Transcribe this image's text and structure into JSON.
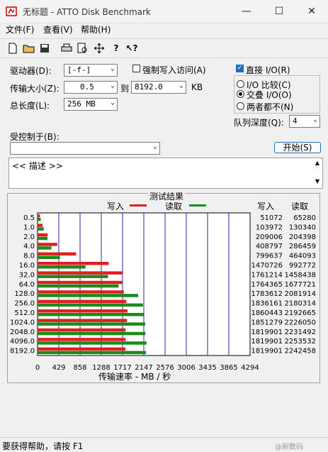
{
  "window": {
    "title": "无标题 - ATTO Disk Benchmark"
  },
  "menu": [
    "文件(F)",
    "查看(V)",
    "帮助(H)"
  ],
  "toolbar": {
    "new": "new-file",
    "open": "open-folder",
    "save": "save",
    "print": "print",
    "preview": "print-preview",
    "move": "move",
    "help": "help",
    "context_help": "context-help"
  },
  "form": {
    "drive_label": "驱动器(D):",
    "drive_value": "[-f-]",
    "force_write_label": "强制写入访问(A)",
    "transfer_label": "传输大小(Z):",
    "transfer_from": "0.5",
    "to_label": "到",
    "transfer_to": "8192.0",
    "kb_label": "KB",
    "length_label": "总长度(L):",
    "length_value": "256 MB",
    "direct_io_label": "直接 I/O(R)",
    "io_compare_label": "I/O 比较(C)",
    "overlap_io_label": "交叠 I/O(O)",
    "neither_label": "两者都不(N)",
    "queue_label": "队列深度(Q):",
    "queue_value": "4",
    "controlled_label": "受控制于(B):",
    "controlled_value": "",
    "start_button": "开始(S)",
    "description": "<< 描述 >>"
  },
  "results": {
    "title": "测试结果",
    "legend_write": "写入",
    "legend_read": "读取",
    "col_write": "写入",
    "col_read": "读取",
    "xlabel": "传输速率 - MB / 秒",
    "write_color": "#e02020",
    "read_color": "#1a8a1a"
  },
  "chart_data": {
    "type": "bar",
    "title": "测试结果",
    "xlabel": "传输速率 - MB / 秒",
    "xlim": [
      0,
      4294
    ],
    "xticks": [
      "0",
      "429",
      "858",
      "1288",
      "1717",
      "2147",
      "2576",
      "3006",
      "3435",
      "3865",
      "4294"
    ],
    "categories": [
      "0.5",
      "1.0",
      "2.0",
      "4.0",
      "8.0",
      "16.0",
      "32.0",
      "64.0",
      "128.0",
      "256.0",
      "512.0",
      "1024.0",
      "2048.0",
      "4096.0",
      "8192.0"
    ],
    "series": [
      {
        "name": "写入",
        "values": [
          50,
          101,
          204,
          399,
          781,
          1436,
          1720,
          1723,
          1742,
          1793,
          1817,
          1808,
          1777,
          1777,
          1777
        ]
      },
      {
        "name": "读取",
        "values": [
          64,
          127,
          200,
          280,
          453,
          969,
          1424,
          1638,
          2033,
          2129,
          2141,
          2174,
          2179,
          2201,
          2190
        ]
      }
    ],
    "write_values": [
      "51072",
      "103972",
      "209006",
      "408797",
      "799637",
      "1470726",
      "1761214",
      "1764365",
      "1783612",
      "1836161",
      "1860443",
      "1851279",
      "1819901",
      "1819901",
      "1819901"
    ],
    "read_values": [
      "65280",
      "130340",
      "204398",
      "286459",
      "464093",
      "992772",
      "1458438",
      "1677721",
      "2081914",
      "2180314",
      "2192665",
      "2226050",
      "2231492",
      "2253532",
      "2242458"
    ]
  },
  "status": {
    "text": "要获得帮助，请按 F1",
    "watermark": "@新数码"
  }
}
